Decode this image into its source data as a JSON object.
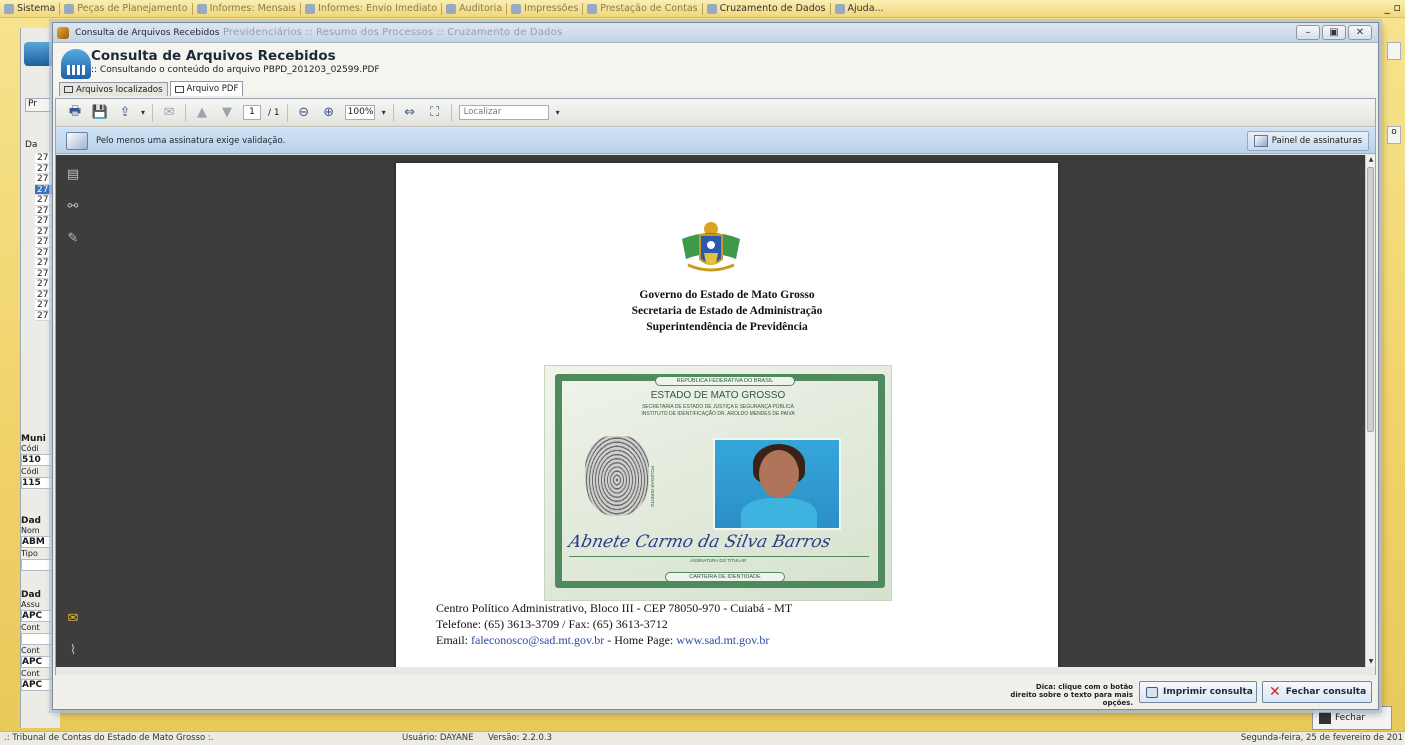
{
  "menubar": {
    "items": [
      {
        "label": "Sistema",
        "icon": "system-icon"
      },
      {
        "label": "Peças de Planejamento",
        "icon": "planning-icon"
      },
      {
        "label": "Informes: Mensais",
        "icon": "report-icon"
      },
      {
        "label": "Informes: Envio Imediato",
        "icon": "report-icon"
      },
      {
        "label": "Auditoria",
        "icon": "audit-icon"
      },
      {
        "label": "Impressões",
        "icon": "print-icon"
      },
      {
        "label": "Prestação de Contas",
        "icon": "money-icon"
      },
      {
        "label": "Cruzamento de Dados",
        "icon": "globe-icon"
      },
      {
        "label": "Ajuda...",
        "icon": "help-icon"
      }
    ]
  },
  "background": {
    "tab_fragment": "Pr",
    "grid_header": "Da",
    "rows": [
      "27",
      "27",
      "27",
      "27",
      "27",
      "27",
      "27",
      "27",
      "27",
      "27",
      "27",
      "27",
      "27",
      "27",
      "27",
      "27"
    ],
    "municipio_label": "Muni",
    "codigo_label": "Códi",
    "codigo_value": "510",
    "codigo2_label": "Códi",
    "codigo2_value": "115",
    "dados_label": "Dad",
    "nome_label": "Nom",
    "nome_value": "ABM",
    "tipo_label": "Tipo",
    "dados2_label": "Dad",
    "assunto_label": "Assu",
    "assunto_value": "APC",
    "conteudo_label": "Cont",
    "conteudo2_label": "Cont",
    "conteudo2_value": "APC",
    "conteudo3_label": "Cont",
    "conteudo3_value": "APC",
    "ghost_title": "Previdenciários :: Resumo dos Processos :: Cruzamento de Dados",
    "right_fragments": [
      "o"
    ],
    "fechar_label": "Fechar"
  },
  "statusbar": {
    "org": ".: Tribunal de Contas do Estado de Mato Grosso :.",
    "user": "Usuário:  DAYANE",
    "version": "Versão: 2.2.0.3",
    "date": "Segunda-feira, 25 de fevereiro de 201"
  },
  "window": {
    "title": "Consulta de Arquivos Recebidos",
    "header_title": "Consulta de Arquivos Recebidos",
    "header_subtitle": ":: Consultando o conteúdo do arquivo PBPD_201203_02599.PDF",
    "tabs": [
      {
        "label": "Arquivos localizados",
        "active": false
      },
      {
        "label": "Arquivo PDF",
        "active": true
      }
    ]
  },
  "toolbar": {
    "page_current": "1",
    "page_total": "/ 1",
    "zoom": "100%",
    "find_placeholder": "Localizar"
  },
  "signature_bar": {
    "message": "Pelo menos uma assinatura exige validação.",
    "panel_button": "Painel de assinaturas"
  },
  "document": {
    "line1": "Governo do Estado de Mato Grosso",
    "line2": "Secretaria de Estado de Administração",
    "line3": "Superintendência de Previdência",
    "id_card": {
      "top_band": "REPÚBLICA FEDERATIVA DO BRASIL",
      "state": "ESTADO DE MATO GROSSO",
      "secretaria": "SECRETARIA DE ESTADO DE JUSTIÇA E SEGURANÇA PÚBLICA",
      "instituto": "INSTITUTO DE IDENTIFICAÇÃO DR. AROLDO MENDES DE PAIVA",
      "polegar": "POLEGAR DIREITO",
      "signature": "Abnete Carmo da Silva Barros",
      "signature_label": "ASSINATURA DO TITULAR",
      "bottom_band": "CARTEIRA DE IDENTIDADE"
    },
    "address": "Centro Político Administrativo, Bloco III - CEP 78050-970 - Cuiabá - MT",
    "phone": "Telefone: (65) 3613-3709 / Fax: (65) 3613-3712",
    "email_label": "Email:",
    "email": "faleconosco@sad.mt.gov.br",
    "homepage_label": "- Home Page:",
    "homepage": "www.sad.mt.gov.br"
  },
  "bottombar": {
    "tip": "Dica: clique com o botão direito sobre o texto para mais opções.",
    "print_button": "Imprimir consulta",
    "close_button": "Fechar consulta"
  }
}
